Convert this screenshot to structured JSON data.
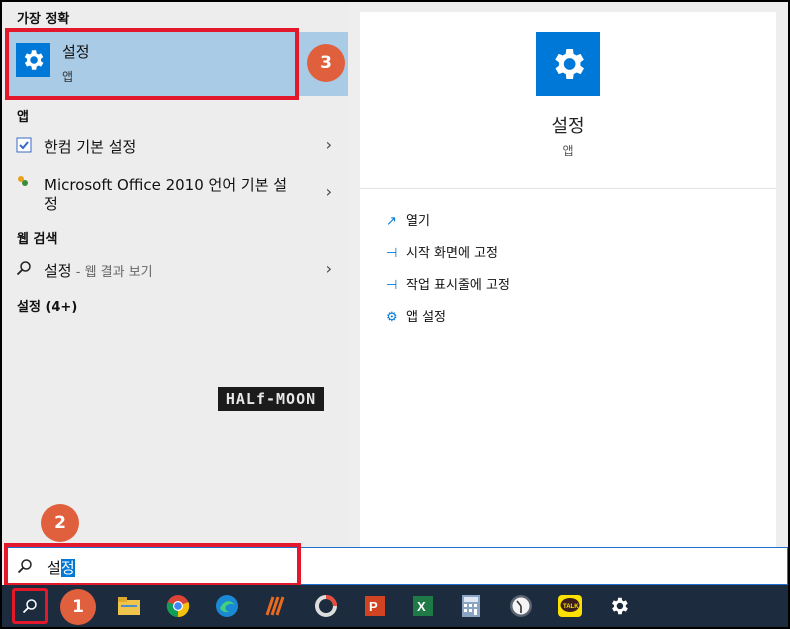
{
  "left": {
    "best_match_header": "가장 정확",
    "best": {
      "name": "설정",
      "sub": "앱",
      "icon": "gear-icon"
    },
    "apps_header": "앱",
    "apps": [
      {
        "label": "한컴 기본 설정",
        "icon": "checklist-icon"
      },
      {
        "label_line1": "Microsoft Office 2010 언어 기본 설",
        "label_line2": "정",
        "icon": "office-icon"
      }
    ],
    "web_header": "웹 검색",
    "web": {
      "label": "설정",
      "suffix": " - 웹 결과 보기",
      "icon": "search-icon"
    },
    "settings_header": "설정 (4+)",
    "watermark": "HALf-MOON"
  },
  "right": {
    "title": "설정",
    "sub": "앱",
    "icon": "gear-icon",
    "actions": [
      {
        "label": "열기",
        "icon": "open-icon"
      },
      {
        "label": "시작 화면에 고정",
        "icon": "pin-icon"
      },
      {
        "label": "작업 표시줄에 고정",
        "icon": "pin-icon"
      },
      {
        "label": "앱 설정",
        "icon": "gear-icon"
      }
    ]
  },
  "search": {
    "typed_plain": "설",
    "typed_selected": "정"
  },
  "badges": {
    "one": "1",
    "two": "2",
    "three": "3"
  },
  "taskbar": {
    "items": [
      "search-icon",
      "file-explorer-icon",
      "chrome-icon",
      "edge-icon",
      "app-icon",
      "circle-app-icon",
      "powerpoint-icon",
      "excel-icon",
      "calculator-icon",
      "clock-icon",
      "kakaotalk-icon",
      "settings-gear-icon"
    ],
    "kakao_label": "TALK"
  },
  "colors": {
    "accent": "#0078d7",
    "highlight": "#a9cbe6",
    "annotation_red": "#e3192b",
    "badge": "#e0603d",
    "taskbar": "#1c2b3d"
  }
}
